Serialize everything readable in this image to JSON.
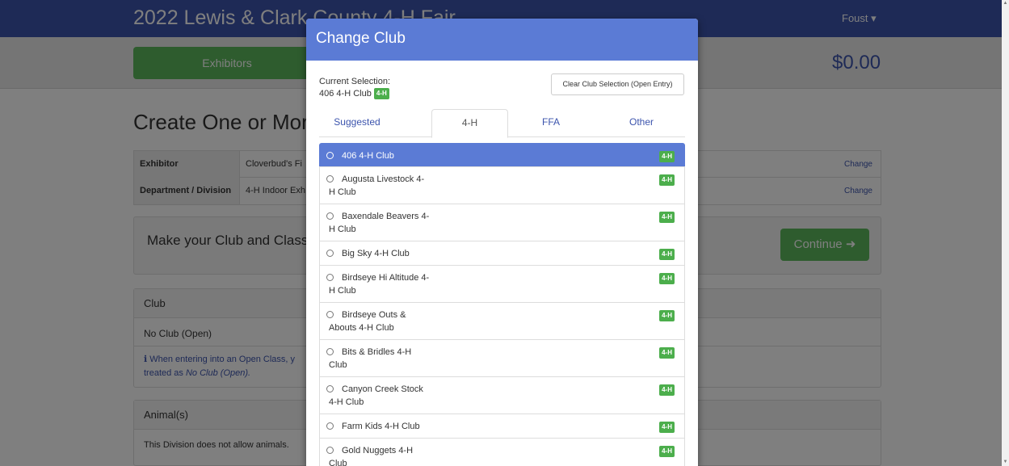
{
  "navbar": {
    "title": "2022 Lewis & Clark County 4-H Fair",
    "user_menu": "Foust ▾"
  },
  "subbar": {
    "exhibitors_label": "Exhibitors",
    "total": "$0.00"
  },
  "page": {
    "heading": "Create One or More",
    "exhibitor_table": [
      {
        "key": "Exhibitor",
        "value": "Cloverbud's Fi",
        "change": "Change"
      },
      {
        "key": "Department / Division",
        "value": "4-H Indoor Exh",
        "change": "Change"
      }
    ],
    "make_selection": "Make your Club and Class",
    "continue_label": "Continue ➜",
    "club_panel": {
      "header": "Club",
      "value": "No Club (Open)",
      "note_line1": "When entering into an Open Class, y",
      "note_line2_prefix": "treated as ",
      "note_line2_em": "No Club (Open)."
    },
    "animal_panel": {
      "header": "Animal(s)",
      "text": "This Division does not allow animals."
    }
  },
  "modal": {
    "title": "Change Club",
    "current_selection_label": "Current Selection:",
    "current_selection_value": "406 4-H Club",
    "current_selection_badge": "4-H",
    "clear_button": "Clear Club Selection (Open Entry)",
    "tabs": [
      {
        "label": "Suggested",
        "active": false
      },
      {
        "label": "4-H",
        "active": true
      },
      {
        "label": "FFA",
        "active": false
      },
      {
        "label": "Other",
        "active": false
      }
    ],
    "clubs": [
      {
        "line1": "406 4-H Club",
        "line2": "",
        "badge": "4-H",
        "selected": true
      },
      {
        "line1": "Augusta Livestock 4-",
        "line2": "H Club",
        "badge": "4-H",
        "selected": false
      },
      {
        "line1": "Baxendale Beavers 4-",
        "line2": "H Club",
        "badge": "4-H",
        "selected": false
      },
      {
        "line1": "Big Sky 4-H Club",
        "line2": "",
        "badge": "4-H",
        "selected": false
      },
      {
        "line1": "Birdseye Hi Altitude 4-",
        "line2": "H Club",
        "badge": "4-H",
        "selected": false
      },
      {
        "line1": "Birdseye Outs &",
        "line2": "Abouts 4-H Club",
        "badge": "4-H",
        "selected": false
      },
      {
        "line1": "Bits & Bridles 4-H",
        "line2": "Club",
        "badge": "4-H",
        "selected": false
      },
      {
        "line1": "Canyon Creek Stock",
        "line2": "4-H Club",
        "badge": "4-H",
        "selected": false
      },
      {
        "line1": "Farm Kids 4-H Club",
        "line2": "",
        "badge": "4-H",
        "selected": false
      },
      {
        "line1": "Gold Nuggets 4-H",
        "line2": "Club",
        "badge": "4-H",
        "selected": false
      }
    ]
  }
}
